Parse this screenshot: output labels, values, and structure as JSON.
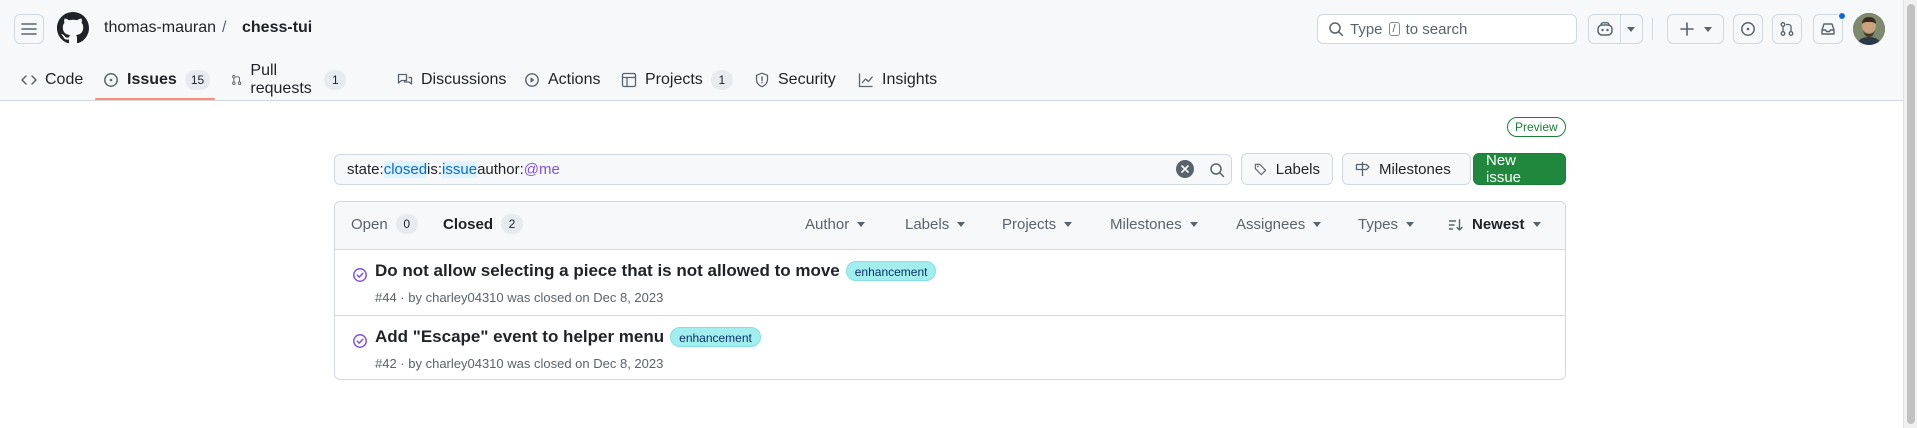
{
  "header": {
    "owner": "thomas-mauran",
    "separator": "/",
    "repo": "chess-tui",
    "search": {
      "prefix": "Type",
      "key": "/",
      "suffix": "to search"
    }
  },
  "nav": {
    "items": [
      {
        "label": "Code",
        "icon": "code-icon"
      },
      {
        "label": "Issues",
        "icon": "issue-opened-icon",
        "count": "15",
        "selected": true
      },
      {
        "label": "Pull requests",
        "icon": "git-pull-request-icon",
        "count": "1"
      },
      {
        "label": "Discussions",
        "icon": "comment-discussion-icon"
      },
      {
        "label": "Actions",
        "icon": "play-icon"
      },
      {
        "label": "Projects",
        "icon": "table-icon",
        "count": "1"
      },
      {
        "label": "Security",
        "icon": "shield-icon"
      },
      {
        "label": "Insights",
        "icon": "graph-icon"
      }
    ]
  },
  "preview_badge": "Preview",
  "filter": {
    "q1_key": "state:",
    "q1_val": "closed",
    "q2_key": " is:",
    "q2_val": "issue",
    "q3_key": " author:",
    "q3_val": "@me"
  },
  "buttons": {
    "labels": "Labels",
    "milestones": "Milestones",
    "new_issue": "New issue"
  },
  "list_header": {
    "open_label": "Open",
    "open_count": "0",
    "closed_label": "Closed",
    "closed_count": "2",
    "filters": [
      "Author",
      "Labels",
      "Projects",
      "Milestones",
      "Assignees",
      "Types"
    ],
    "sort": "Newest"
  },
  "issues": [
    {
      "title": "Do not allow selecting a piece that is not allowed to move",
      "label": "enhancement",
      "meta": "#44 · by charley04310 was closed on Dec 8, 2023"
    },
    {
      "title": "Add \"Escape\" event to helper menu",
      "label": "enhancement",
      "meta": "#42 · by charley04310 was closed on Dec 8, 2023"
    }
  ],
  "colors": {
    "accent": "#0969da",
    "primary_button": "#1f883d",
    "closed_icon": "#8250df",
    "label_bg": "#a2eeef",
    "selected_underline": "#fd8c73"
  }
}
